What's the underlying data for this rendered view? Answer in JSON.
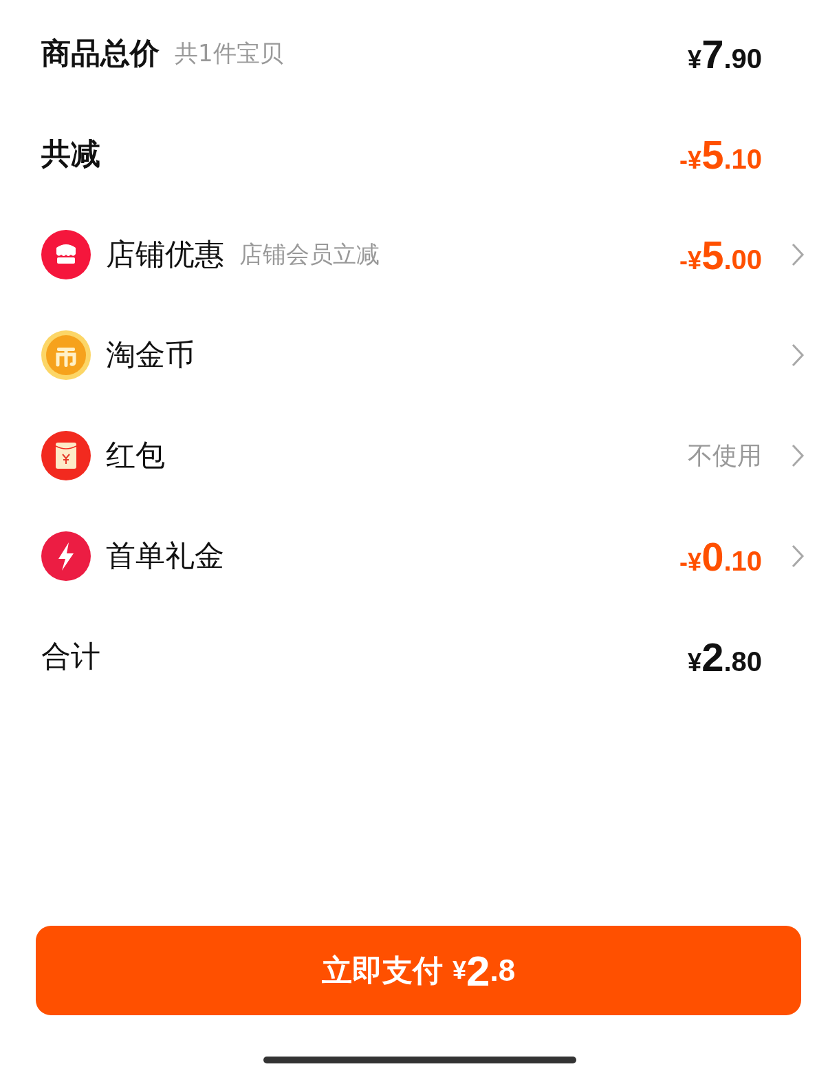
{
  "rows": [
    {
      "kind": "summary",
      "label": "商品总价",
      "note": "共1件宝贝",
      "price": {
        "sign": "¥",
        "integer": "7",
        "decimal": ".90",
        "color": "#111111"
      },
      "chevron": false
    },
    {
      "kind": "summary",
      "label": "共减",
      "price": {
        "sign": "-¥",
        "integer": "5",
        "decimal": ".10",
        "color": "#ff5000"
      },
      "chevron": false
    },
    {
      "kind": "store",
      "label": "店铺优惠",
      "note": "店铺会员立减",
      "price": {
        "sign": "-¥",
        "integer": "5",
        "decimal": ".00",
        "color": "#ff5000"
      },
      "chevron": true
    },
    {
      "kind": "coin",
      "label": "淘金币",
      "chevron": true
    },
    {
      "kind": "envelope",
      "label": "红包",
      "value": "不使用",
      "chevron": true
    },
    {
      "kind": "bolt",
      "label": "首单礼金",
      "price": {
        "sign": "-¥",
        "integer": "0",
        "decimal": ".10",
        "color": "#ff5000"
      },
      "chevron": true
    },
    {
      "kind": "summary",
      "label": "合计",
      "price": {
        "sign": "¥",
        "integer": "2",
        "decimal": ".80",
        "color": "#111111"
      },
      "chevron": false
    }
  ],
  "pay_button": {
    "label": "立即支付",
    "price": {
      "sign": "¥",
      "integer": "2",
      "decimal": ".8"
    }
  }
}
